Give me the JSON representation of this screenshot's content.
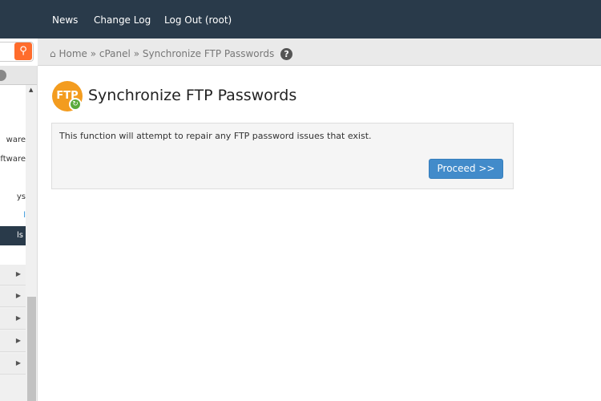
{
  "topnav": {
    "items": [
      "News",
      "Change Log",
      "Log Out (root)"
    ]
  },
  "sidebar": {
    "items": [
      {
        "label": "ware"
      },
      {
        "label": "ftware"
      },
      {
        "label": "ys"
      },
      {
        "label": "l"
      },
      {
        "label": "ls"
      }
    ]
  },
  "breadcrumb": {
    "home": "Home",
    "sep": "»",
    "cpanel": "cPanel",
    "current": "Synchronize FTP Passwords",
    "help": "?"
  },
  "page": {
    "logo_text": "FTP",
    "title": "Synchronize FTP Passwords",
    "description": "This function will attempt to repair any FTP password issues that exist.",
    "proceed_label": "Proceed >>"
  }
}
